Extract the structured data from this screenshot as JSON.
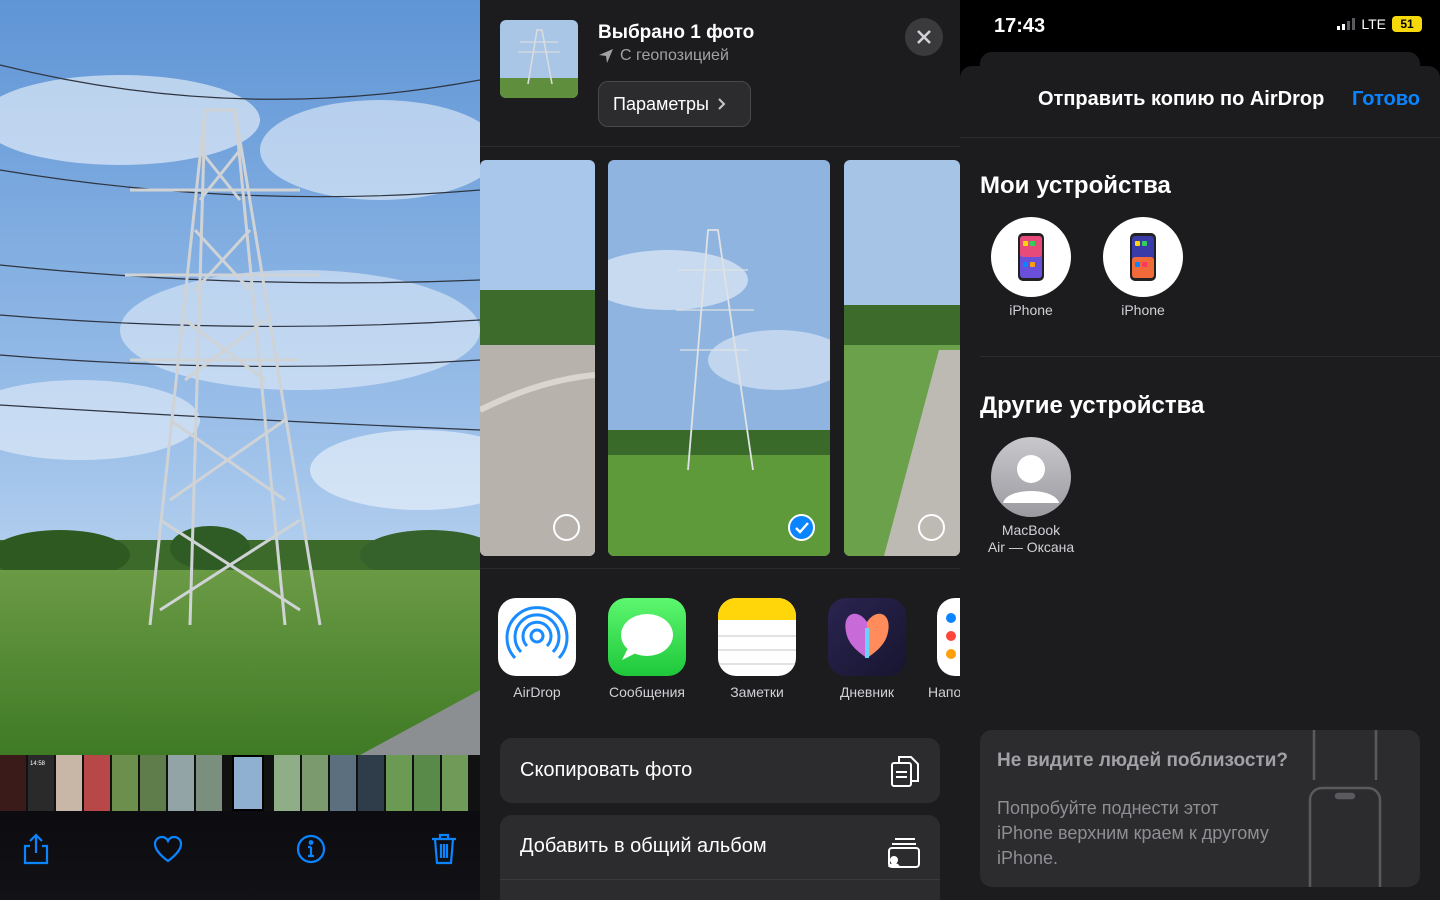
{
  "viewer": {
    "toolbar": {
      "share": "share-icon",
      "favorite": "heart-icon",
      "info": "info-icon",
      "delete": "trash-icon"
    },
    "thumb_timestamp": "14:58",
    "accent": "#0a84ff"
  },
  "share_sheet": {
    "title": "Выбрано 1 фото",
    "subtitle": "С геопозицией",
    "params_label": "Параметры",
    "apps": [
      {
        "label": "AirDrop",
        "icon": "airdrop-icon"
      },
      {
        "label": "Сообщения",
        "icon": "messages-icon"
      },
      {
        "label": "Заметки",
        "icon": "notes-icon"
      },
      {
        "label": "Дневник",
        "icon": "journal-icon"
      },
      {
        "label": "Напо",
        "icon": "reminders-icon"
      }
    ],
    "actions": [
      {
        "label": "Скопировать фото",
        "icon": "copy-icon"
      },
      {
        "label": "Добавить в общий альбом",
        "icon": "shared-album-icon"
      }
    ]
  },
  "airdrop": {
    "status": {
      "time": "17:43",
      "network": "LTE",
      "battery": "51"
    },
    "title": "Отправить копию по AirDrop",
    "done": "Готово",
    "my_devices_heading": "Мои устройства",
    "my_devices": [
      {
        "label": "iPhone"
      },
      {
        "label": "iPhone"
      }
    ],
    "other_devices_heading": "Другие устройства",
    "other_devices": [
      {
        "label_line1": "MacBook",
        "label_line2": "Air — Оксана"
      }
    ],
    "hint_heading": "Не видите людей поблизости?",
    "hint_body": "Попробуйте поднести этот iPhone верхним краем к другому iPhone."
  }
}
